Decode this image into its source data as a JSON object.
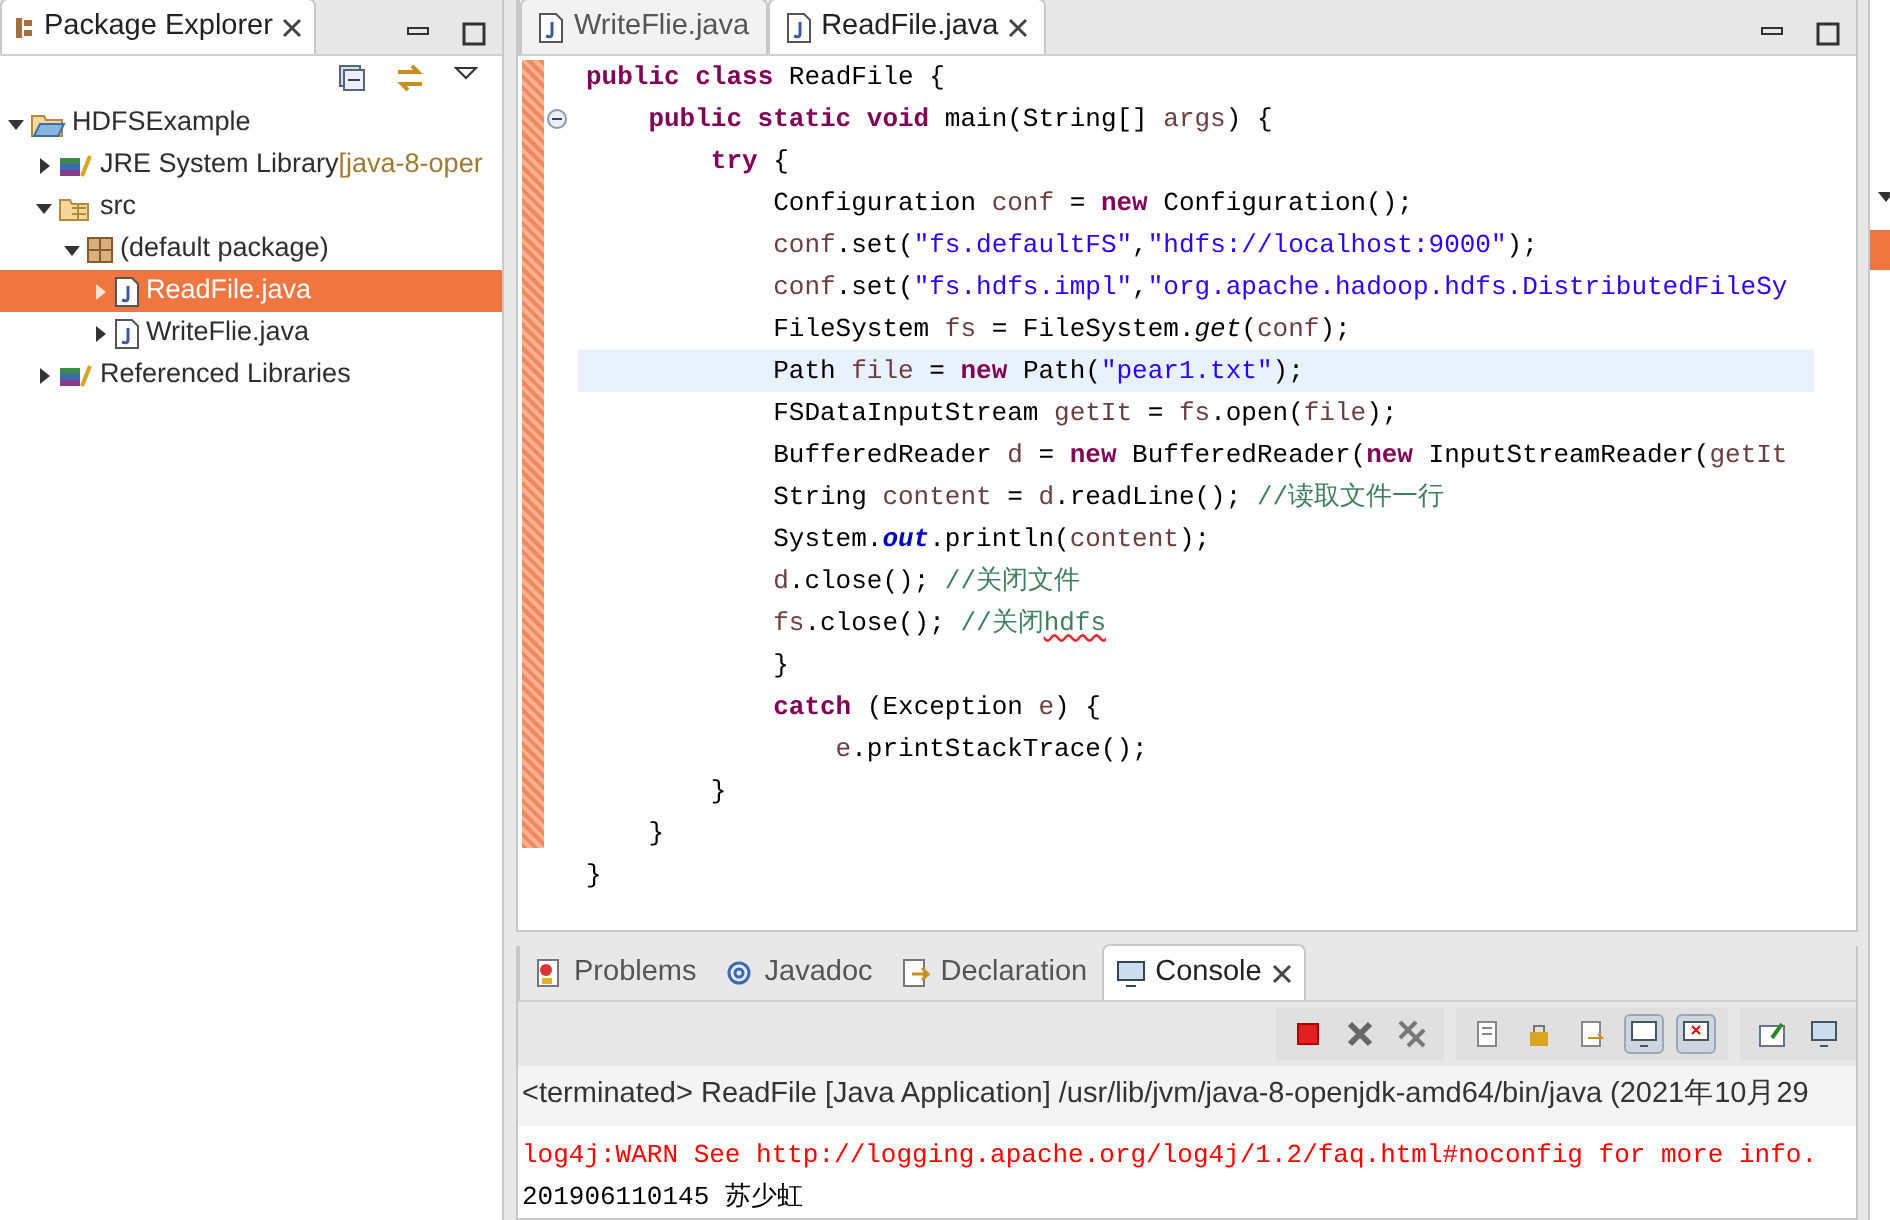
{
  "package_explorer": {
    "title": "Package Explorer",
    "tree": [
      {
        "label": "HDFSExample",
        "kind": "project",
        "expanded": true,
        "selected": false,
        "children": [
          {
            "label": "JRE System Library",
            "decoration": "[java-8-oper",
            "kind": "library",
            "expanded": false,
            "selected": false
          },
          {
            "label": "src",
            "kind": "folder",
            "expanded": true,
            "selected": false,
            "children": [
              {
                "label": "(default package)",
                "kind": "package",
                "expanded": true,
                "selected": false,
                "children": [
                  {
                    "label": "ReadFile.java",
                    "kind": "java",
                    "expanded": false,
                    "selected": true
                  },
                  {
                    "label": "WriteFlie.java",
                    "kind": "java",
                    "expanded": false,
                    "selected": false
                  }
                ]
              }
            ]
          },
          {
            "label": "Referenced Libraries",
            "kind": "library",
            "expanded": false,
            "selected": false
          }
        ]
      }
    ]
  },
  "editor": {
    "tabs": [
      {
        "label": "WriteFlie.java",
        "selected": false
      },
      {
        "label": "ReadFile.java",
        "selected": true
      }
    ],
    "lines": [
      {
        "highlighted": false,
        "tokens": [
          {
            "kind": "keyword",
            "text": "public class"
          },
          {
            "kind": "plain",
            "text": " ReadFile {"
          }
        ],
        "children": [
          {
            "folded": false,
            "highlighted": false,
            "tokens": [
              {
                "kind": "keyword",
                "text": "public static void"
              },
              {
                "kind": "plain",
                "text": " main(String[] "
              },
              {
                "kind": "variable",
                "text": "args"
              },
              {
                "kind": "plain",
                "text": ") {"
              }
            ],
            "children": [
              {
                "highlighted": false,
                "tokens": [
                  {
                    "kind": "keyword",
                    "text": "try"
                  },
                  {
                    "kind": "plain",
                    "text": " {"
                  }
                ],
                "children": [
                  {
                    "highlighted": false,
                    "tokens": [
                      {
                        "kind": "plain",
                        "text": "Configuration "
                      },
                      {
                        "kind": "variable",
                        "text": "conf"
                      },
                      {
                        "kind": "plain",
                        "text": " = "
                      },
                      {
                        "kind": "keyword",
                        "text": "new"
                      },
                      {
                        "kind": "plain",
                        "text": " Configuration();"
                      }
                    ]
                  },
                  {
                    "highlighted": false,
                    "tokens": [
                      {
                        "kind": "variable",
                        "text": "conf"
                      },
                      {
                        "kind": "plain",
                        "text": ".set("
                      },
                      {
                        "kind": "string",
                        "text": "\"fs.defaultFS\""
                      },
                      {
                        "kind": "plain",
                        "text": ","
                      },
                      {
                        "kind": "string",
                        "text": "\"hdfs://localhost:9000\""
                      },
                      {
                        "kind": "plain",
                        "text": ");"
                      }
                    ]
                  },
                  {
                    "highlighted": false,
                    "tokens": [
                      {
                        "kind": "variable",
                        "text": "conf"
                      },
                      {
                        "kind": "plain",
                        "text": ".set("
                      },
                      {
                        "kind": "string",
                        "text": "\"fs.hdfs.impl\""
                      },
                      {
                        "kind": "plain",
                        "text": ","
                      },
                      {
                        "kind": "string",
                        "text": "\"org.apache.hadoop.hdfs.DistributedFileSy"
                      }
                    ]
                  },
                  {
                    "highlighted": false,
                    "tokens": [
                      {
                        "kind": "plain",
                        "text": "FileSystem "
                      },
                      {
                        "kind": "variable",
                        "text": "fs"
                      },
                      {
                        "kind": "plain",
                        "text": " = FileSystem."
                      },
                      {
                        "kind": "static",
                        "text": "get"
                      },
                      {
                        "kind": "plain",
                        "text": "("
                      },
                      {
                        "kind": "variable",
                        "text": "conf"
                      },
                      {
                        "kind": "plain",
                        "text": ");"
                      }
                    ]
                  },
                  {
                    "highlighted": true,
                    "tokens": [
                      {
                        "kind": "plain",
                        "text": "Path "
                      },
                      {
                        "kind": "variable",
                        "text": "file"
                      },
                      {
                        "kind": "plain",
                        "text": " = "
                      },
                      {
                        "kind": "keyword",
                        "text": "new"
                      },
                      {
                        "kind": "plain",
                        "text": " Path("
                      },
                      {
                        "kind": "string",
                        "text": "\"pear1.txt\""
                      },
                      {
                        "kind": "plain",
                        "text": ");"
                      }
                    ]
                  },
                  {
                    "highlighted": false,
                    "tokens": [
                      {
                        "kind": "plain",
                        "text": "FSDataInputStream "
                      },
                      {
                        "kind": "variable",
                        "text": "getIt"
                      },
                      {
                        "kind": "plain",
                        "text": " = "
                      },
                      {
                        "kind": "variable",
                        "text": "fs"
                      },
                      {
                        "kind": "plain",
                        "text": ".open("
                      },
                      {
                        "kind": "variable",
                        "text": "file"
                      },
                      {
                        "kind": "plain",
                        "text": ");"
                      }
                    ]
                  },
                  {
                    "highlighted": false,
                    "tokens": [
                      {
                        "kind": "plain",
                        "text": "BufferedReader "
                      },
                      {
                        "kind": "variable",
                        "text": "d"
                      },
                      {
                        "kind": "plain",
                        "text": " = "
                      },
                      {
                        "kind": "keyword",
                        "text": "new"
                      },
                      {
                        "kind": "plain",
                        "text": " BufferedReader("
                      },
                      {
                        "kind": "keyword",
                        "text": "new"
                      },
                      {
                        "kind": "plain",
                        "text": " InputStreamReader("
                      },
                      {
                        "kind": "variable",
                        "text": "getIt"
                      }
                    ]
                  },
                  {
                    "highlighted": false,
                    "tokens": [
                      {
                        "kind": "plain",
                        "text": "String "
                      },
                      {
                        "kind": "variable",
                        "text": "content"
                      },
                      {
                        "kind": "plain",
                        "text": " = "
                      },
                      {
                        "kind": "variable",
                        "text": "d"
                      },
                      {
                        "kind": "plain",
                        "text": ".readLine(); "
                      },
                      {
                        "kind": "comment",
                        "text": "//读取文件一行"
                      }
                    ]
                  },
                  {
                    "highlighted": false,
                    "tokens": [
                      {
                        "kind": "plain",
                        "text": "System."
                      },
                      {
                        "kind": "field",
                        "text": "out"
                      },
                      {
                        "kind": "plain",
                        "text": ".println("
                      },
                      {
                        "kind": "variable",
                        "text": "content"
                      },
                      {
                        "kind": "plain",
                        "text": ");"
                      }
                    ]
                  },
                  {
                    "highlighted": false,
                    "tokens": [
                      {
                        "kind": "variable",
                        "text": "d"
                      },
                      {
                        "kind": "plain",
                        "text": ".close(); "
                      },
                      {
                        "kind": "comment",
                        "text": "//关闭文件"
                      }
                    ]
                  },
                  {
                    "highlighted": false,
                    "tokens": [
                      {
                        "kind": "variable",
                        "text": "fs"
                      },
                      {
                        "kind": "plain",
                        "text": ".close(); "
                      },
                      {
                        "kind": "comment",
                        "text": "//关闭"
                      },
                      {
                        "kind": "misspelled",
                        "text": "hdfs"
                      }
                    ]
                  },
                  {
                    "highlighted": false,
                    "tokens": [
                      {
                        "kind": "plain",
                        "text": "}"
                      }
                    ]
                  },
                  {
                    "highlighted": false,
                    "tokens": [
                      {
                        "kind": "keyword",
                        "text": "catch"
                      },
                      {
                        "kind": "plain",
                        "text": " (Exception "
                      },
                      {
                        "kind": "variable",
                        "text": "e"
                      },
                      {
                        "kind": "plain",
                        "text": ") {"
                      }
                    ],
                    "children": [
                      {
                        "highlighted": false,
                        "tokens": [
                          {
                            "kind": "variable",
                            "text": "e"
                          },
                          {
                            "kind": "plain",
                            "text": ".printStackTrace();"
                          }
                        ]
                      }
                    ]
                  }
                ]
              },
              {
                "highlighted": false,
                "tokens": [
                  {
                    "kind": "plain",
                    "text": "}"
                  }
                ]
              }
            ]
          },
          {
            "highlighted": false,
            "tokens": [
              {
                "kind": "plain",
                "text": "}"
              }
            ]
          }
        ]
      },
      {
        "highlighted": false,
        "tokens": [
          {
            "kind": "plain",
            "text": "}"
          }
        ]
      }
    ]
  },
  "console_view": {
    "tabs": [
      {
        "label": "Problems",
        "kind": "problems",
        "selected": false
      },
      {
        "label": "Javadoc",
        "kind": "javadoc",
        "selected": false
      },
      {
        "label": "Declaration",
        "kind": "declaration",
        "selected": false
      },
      {
        "label": "Console",
        "kind": "console",
        "selected": true
      }
    ],
    "header": "<terminated> ReadFile [Java Application] /usr/lib/jvm/java-8-openjdk-amd64/bin/java (2021年10月29",
    "output": [
      {
        "kind": "stderr",
        "text": "log4j:WARN See http://logging.apache.org/log4j/1.2/faq.html#noconfig for more info."
      },
      {
        "kind": "stdout",
        "text": "201906110145 苏少虹"
      }
    ]
  }
}
